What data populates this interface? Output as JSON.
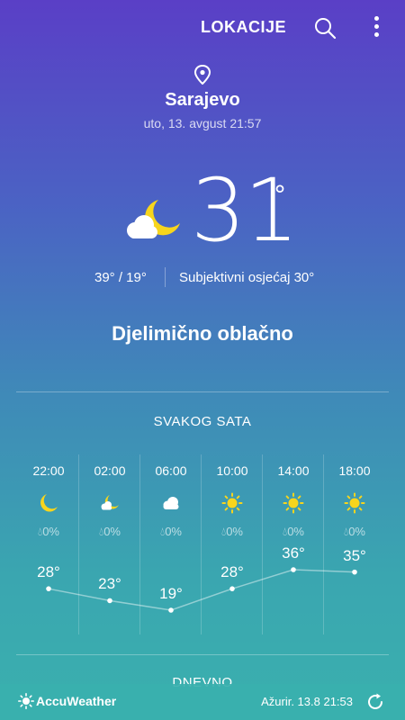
{
  "header": {
    "locations_label": "LOKACIJE"
  },
  "location": {
    "city": "Sarajevo",
    "datetime": "uto, 13. avgust 21:57"
  },
  "current": {
    "temperature": "31",
    "unit": "°",
    "hi_lo": "39°  /  19°",
    "feels_like": "Subjektivni osjećaj 30°",
    "condition": "Djelimično oblačno",
    "icon": "moon-cloud-icon"
  },
  "hourly": {
    "title": "SVAKOG SATA",
    "items": [
      {
        "time": "22:00",
        "icon": "moon-icon",
        "precip": "0%",
        "temp": "28°",
        "value": 28
      },
      {
        "time": "02:00",
        "icon": "moon-cloud-icon",
        "precip": "0%",
        "temp": "23°",
        "value": 23
      },
      {
        "time": "06:00",
        "icon": "cloud-icon",
        "precip": "0%",
        "temp": "19°",
        "value": 19
      },
      {
        "time": "10:00",
        "icon": "sun-icon",
        "precip": "0%",
        "temp": "28°",
        "value": 28
      },
      {
        "time": "14:00",
        "icon": "sun-icon",
        "precip": "0%",
        "temp": "36°",
        "value": 36
      },
      {
        "time": "18:00",
        "icon": "sun-icon",
        "precip": "0%",
        "temp": "35°",
        "value": 35
      }
    ]
  },
  "daily": {
    "title": "DNEVNO"
  },
  "footer": {
    "brand": "AccuWeather",
    "updated": "Ažurir.   13.8   21:53"
  },
  "colors": {
    "sun": "#f7d51d",
    "moon": "#f7d51d",
    "cloud": "#ffffff"
  }
}
